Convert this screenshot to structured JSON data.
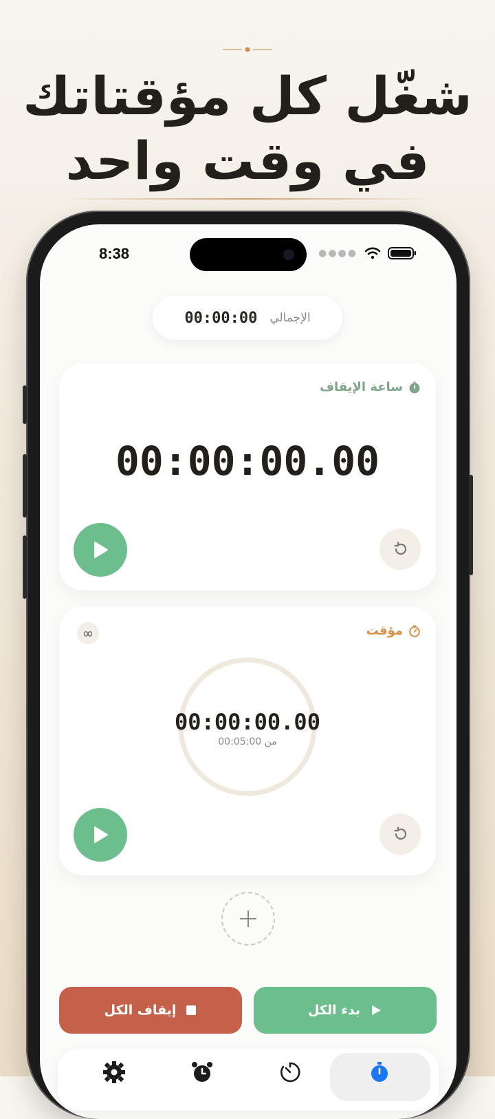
{
  "headline": {
    "line1": "شغّل كل مؤقتاتك",
    "line2": "في وقت واحد"
  },
  "status_bar": {
    "time": "8:38"
  },
  "total": {
    "label": "الإجمالي",
    "value": "00:00:00"
  },
  "stopwatch": {
    "title": "ساعة الإيقاف",
    "time": "00:00:00.00",
    "icon": "stopwatch-icon"
  },
  "timer": {
    "title": "مؤقت",
    "time": "00:00:00.00",
    "subtitle": "من 00:05:00",
    "repeat_symbol": "∞",
    "progress": 0
  },
  "actions": {
    "stop_all": "إيقاف الكل",
    "start_all": "بدء الكل"
  },
  "tabs": [
    {
      "icon": "gear-icon"
    },
    {
      "icon": "alarm-clock-icon"
    },
    {
      "icon": "timer-icon"
    },
    {
      "icon": "stopwatch-icon",
      "active": true
    }
  ],
  "colors": {
    "green": "#6cbe8c",
    "orange": "#d88f45",
    "red": "#c5614a",
    "active_tab": "#1877f2"
  }
}
